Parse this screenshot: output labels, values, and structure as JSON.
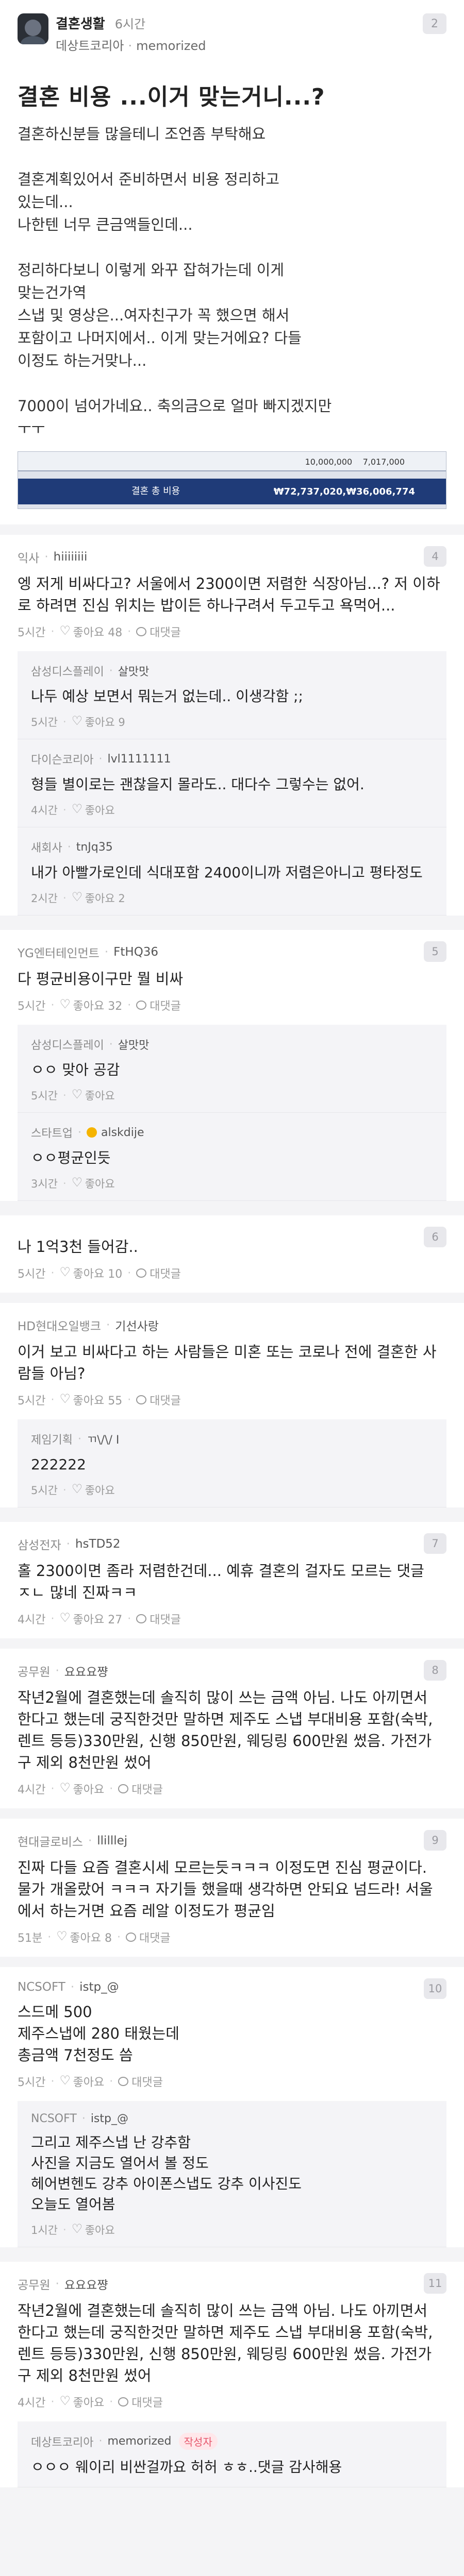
{
  "post": {
    "community": "결혼생활",
    "time": "6시간",
    "author_company": "데상트코리아",
    "author_nick": "memorized",
    "badge": "2",
    "title": "결혼 비용 ...이거 맞는거니...?",
    "lines": [
      "결혼하신분들 많을테니 조언좀 부탁해요",
      "",
      "결혼계획있어서 준비하면서 비용 정리하고",
      "있는데...",
      "나한텐 너무 큰금액들인데...",
      "",
      "정리하다보니 이렇게 와꾸 잡혀가는데 이게",
      "맞는건가역",
      "스냅 및 영상은...여자친구가 꼭 했으면 해서",
      "포함이고 나머지에서.. 이게 맞는거에요? 다들",
      "이정도 하는거맞나...",
      "",
      "7000이 넘어가네요.. 축의금으로 얼마 빠지겠지만",
      "ㅜㅜ"
    ],
    "image": {
      "label": "결혼 총 비용",
      "top_value": "10,000,000",
      "top_value2": "7,017,000",
      "total": "₩72,737,020,",
      "total2": "₩36,006,774"
    }
  },
  "comments": [
    {
      "num": "4",
      "company": "익사",
      "nick": "hiiiiiiii",
      "text": "엥 저게 비싸다고? 서울에서 2300이면 저렴한 식장아님...? 저 이하로 하려면 진심 위치는 밥이든 하나구려서 두고두고 욕먹어...",
      "time": "5시간",
      "likes": "좋아요 48",
      "reply": "대댓글",
      "replies": [
        {
          "company": "삼성디스플레이",
          "nick": "살맛맛",
          "text": "나두 예상 보면서 뭐는거 없는데.. 이생각함 ;;",
          "time": "5시간",
          "likes": "좋아요 9"
        },
        {
          "company": "다이슨코리아",
          "nick": "lvl1111111",
          "text": "형들 별이로는 괜찮을지 몰라도.. 대다수 그렇수는 없어.",
          "time": "4시간",
          "likes": "좋아요"
        },
        {
          "company": "새회사",
          "nick": "tnJq35",
          "text": "내가 아빨가로인데 식대포함 2400이니까 저렴은아니고 평타정도",
          "time": "2시간",
          "likes": "좋아요 2"
        }
      ]
    },
    {
      "num": "5",
      "company": "YG엔터테인먼트",
      "nick": "FtHQ36",
      "text": "다 평균비용이구만 뭘 비싸",
      "time": "5시간",
      "likes": "좋아요 32",
      "reply": "대댓글",
      "replies": [
        {
          "company": "삼성디스플레이",
          "nick": "살맛맛",
          "text": "ㅇㅇ 맞아 공감",
          "time": "5시간",
          "likes": "좋아요"
        },
        {
          "company": "스타트업",
          "nick": "alskdije",
          "text": "ㅇㅇ평균인듯",
          "time": "3시간",
          "likes": "좋아요",
          "gold": true
        }
      ]
    },
    {
      "num": "6",
      "company": "",
      "nick": "",
      "text": "나 1억3천 들어감..",
      "time": "5시간",
      "likes": "좋아요 10",
      "reply": "대댓글",
      "replies": []
    },
    {
      "num": "",
      "company": "HD현대오일뱅크",
      "nick": "기선사랑",
      "text": "이거 보고 비싸다고 하는 사람들은 미혼 또는 코로나 전에 결혼한 사람들 아님?",
      "time": "5시간",
      "likes": "좋아요 55",
      "reply": "대댓글",
      "replies": [
        {
          "company": "제임기획",
          "nick": "ㄲ\\/\\/ I",
          "text": "222222",
          "time": "5시간",
          "likes": "좋아요"
        }
      ]
    },
    {
      "num": "7",
      "company": "삼성전자",
      "nick": "hsTD52",
      "text": "홀 2300이면 좀라 저렴한건데... 예휴 결혼의 걸자도 모르는 댓글 ㅈㄴ 많네 진짜ㅋㅋ",
      "time": "4시간",
      "likes": "좋아요 27",
      "reply": "대댓글",
      "replies": []
    },
    {
      "num": "8",
      "company": "공무원",
      "nick": "요요요쨩",
      "text": "작년2월에 결혼했는데 솔직히 많이 쓰는 금액 아님. 나도 아끼면서 한다고 했는데 궁직한것만 말하면 제주도 스냅 부대비용 포함(숙박, 렌트 등등)330만원, 신행 850만원, 웨딩링 600만원 썼음. 가전가구 제외 8천만원 썼어",
      "time": "4시간",
      "likes": "좋아요",
      "reply": "대댓글",
      "replies": []
    },
    {
      "num": "9",
      "company": "현대글로비스",
      "nick": "llilllej",
      "text": "진짜 다들 요즘 결혼시세 모르는듯ㅋㅋㅋ 이정도면 진심 평균이다. 물가 개올랐어 ㅋㅋㅋ 자기들 했을때 생각하면 안되요 넘드라! 서울에서 하는거면 요즘 레알 이정도가 평균임",
      "time": "51분",
      "likes": "좋아요 8",
      "reply": "대댓글",
      "replies": []
    },
    {
      "num": "10",
      "company": "NCSOFT",
      "nick": "istp_@",
      "text": "스드메 500\n제주스냅에 280 태웠는데\n총금액 7천정도 씀",
      "time": "5시간",
      "likes": "좋아요",
      "reply": "대댓글",
      "replies": [
        {
          "company": "NCSOFT",
          "nick": "istp_@",
          "text": "그리고 제주스냅 난 강추함\n사진을 지금도 열어서 볼 정도\n헤어변헨도 강추 아이폰스냅도 강추 이사진도\n오늘도 열어봄",
          "time": "1시간",
          "likes": "좋아요"
        }
      ]
    },
    {
      "num": "11",
      "company": "공무원",
      "nick": "요요요쨩",
      "text": "작년2월에 결혼했는데 솔직히 많이 쓰는 금액 아님. 나도 아끼면서 한다고 했는데 궁직한것만 말하면 제주도 스냅 부대비용 포함(숙박, 렌트 등등)330만원, 신행 850만원, 웨딩링 600만원 썼음. 가전가구 제외 8천만원 썼어",
      "time": "4시간",
      "likes": "좋아요",
      "reply": "대댓글",
      "replies": [
        {
          "company": "데상트코리아",
          "nick": "memorized",
          "text": "ㅇㅇㅇ 웨이리 비싼걸까요 허허 ㅎㅎ..댓글 감사해용",
          "time": "",
          "likes": "",
          "author": "작성자"
        }
      ]
    }
  ]
}
